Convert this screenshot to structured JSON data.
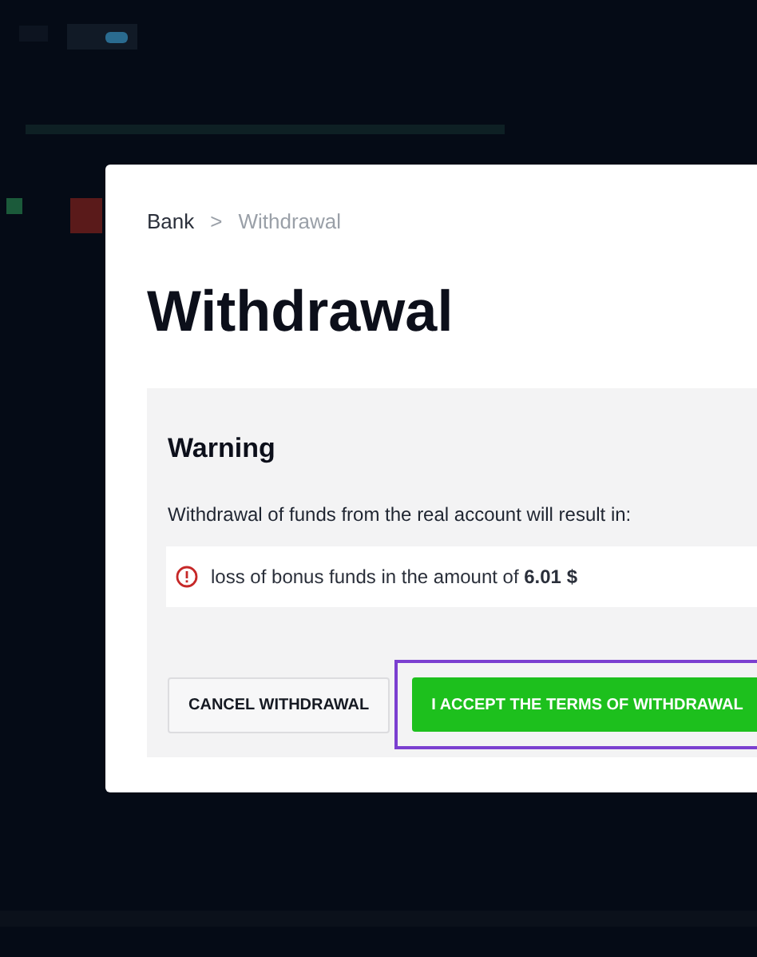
{
  "breadcrumb": [
    {
      "label": "Bank",
      "current": false
    },
    {
      "label": "Withdrawal",
      "current": true
    }
  ],
  "breadcrumb_separator": ">",
  "title": "Withdrawal",
  "warning": {
    "heading": "Warning",
    "message": "Withdrawal of funds from the real account will result in:",
    "items": [
      {
        "text": "loss of bonus funds in the amount of **6.01 $**"
      }
    ]
  },
  "buttons": [
    {
      "label": "CANCEL WITHDRAWAL",
      "kind": "secondary",
      "highlighted": false
    },
    {
      "label": "I ACCEPT THE TERMS OF WITHDRAWAL",
      "kind": "primary",
      "highlighted": true
    }
  ]
}
